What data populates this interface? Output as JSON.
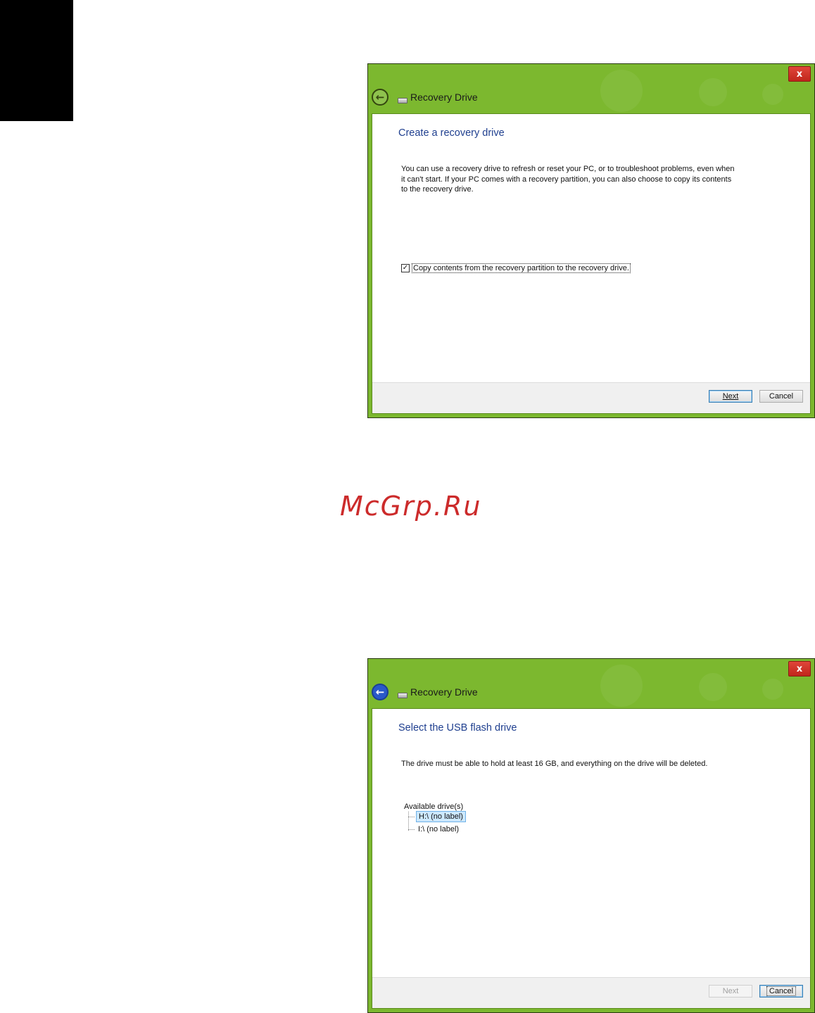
{
  "windows": [
    {
      "title": "Recovery Drive",
      "close_label": "x",
      "heading": "Create a recovery drive",
      "description_lines": [
        "You can use a recovery drive to refresh or reset your PC, or to troubleshoot problems, even when",
        "it can't start. If your PC comes with a recovery partition, you can also choose to copy its contents",
        "to the recovery drive."
      ],
      "checkbox": {
        "checked": true,
        "label": "Copy contents from the recovery partition to the recovery drive."
      },
      "buttons": {
        "next": "Next",
        "cancel": "Cancel"
      }
    },
    {
      "title": "Recovery Drive",
      "close_label": "x",
      "heading": "Select the USB flash drive",
      "description": "The drive must be able to hold at least 16 GB, and everything on the drive will be deleted.",
      "drives": {
        "label": "Available drive(s)",
        "items": [
          {
            "text": "H:\\ (no label)",
            "selected": true
          },
          {
            "text": "I:\\ (no label)",
            "selected": false
          }
        ]
      },
      "buttons": {
        "next": "Next",
        "cancel": "Cancel"
      }
    }
  ],
  "watermark": "McGrp.Ru",
  "colors": {
    "title_bar": "#7cb82f",
    "heading": "#1f3f8f",
    "watermark": "#cc2b2b"
  }
}
